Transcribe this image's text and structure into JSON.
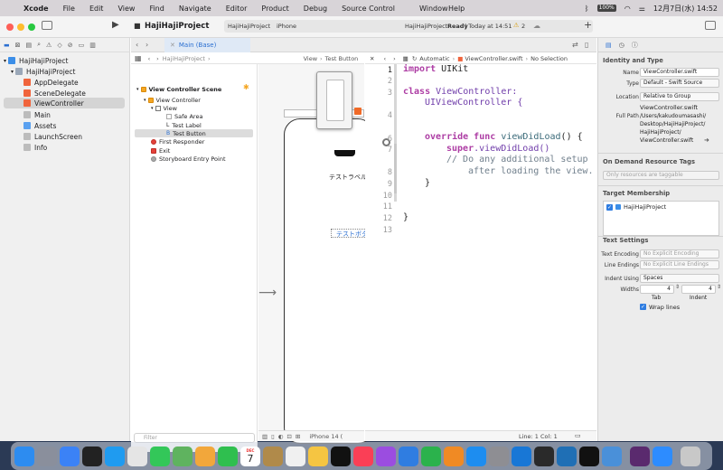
{
  "menubar": {
    "apple": "",
    "app": "Xcode",
    "items": [
      "File",
      "Edit",
      "View",
      "Find",
      "Navigate",
      "Editor",
      "Product",
      "Debug",
      "Source Control"
    ],
    "window": "Window",
    "help": "Help",
    "battery": "100%",
    "clock": "12月7日(水) 14:52"
  },
  "toolbar": {
    "project_name": "HajiHajiProject",
    "scheme": "HajiHajiProject",
    "device": "iPhone",
    "status_project": "HajiHajiProject:",
    "status_ready": "Ready",
    "status_time": "| Today at 14:51",
    "warnings": "2"
  },
  "navigator": {
    "items": [
      {
        "label": "HajiHajiProject",
        "kind": "project"
      },
      {
        "label": "HajiHajiProject",
        "kind": "folder"
      },
      {
        "label": "AppDelegate",
        "kind": "swift"
      },
      {
        "label": "SceneDelegate",
        "kind": "swift"
      },
      {
        "label": "ViewController",
        "kind": "swift"
      },
      {
        "label": "Main",
        "kind": "storyboard"
      },
      {
        "label": "Assets",
        "kind": "assets"
      },
      {
        "label": "LaunchScreen",
        "kind": "storyboard"
      },
      {
        "label": "Info",
        "kind": "plist"
      }
    ],
    "filter_placeholder": "Filter"
  },
  "editor_tab": {
    "label": "Main (Base)"
  },
  "ib_breadcrumb": {
    "project": "HajiHajiProject",
    "view": "View",
    "item": "Test Button"
  },
  "scene_outline": {
    "items": [
      {
        "label": "View Controller Scene"
      },
      {
        "label": "View Controller"
      },
      {
        "label": "View"
      },
      {
        "label": "Safe Area"
      },
      {
        "label": "Test Label"
      },
      {
        "label": "Test Button"
      },
      {
        "label": "First Responder"
      },
      {
        "label": "Exit"
      },
      {
        "label": "Storyboard Entry Point"
      }
    ],
    "filter_placeholder": "Filter"
  },
  "canvas": {
    "label_text": "テストラベル",
    "button_text": "テストボタン",
    "device_label": "iPhone 14 ("
  },
  "code_breadcrumb": {
    "mode": "Automatic",
    "file": "ViewController.swift",
    "selection": "No Selection"
  },
  "code": {
    "line_numbers": [
      "1",
      "2",
      "3",
      "4",
      "5",
      "6",
      "7",
      "8",
      "9",
      "10",
      "11",
      "12",
      "13"
    ],
    "line1_kw": "import",
    "line1_mod": "UIKit",
    "line3_kw": "class",
    "line3_name": "ViewController:",
    "line3_super": "UIViewController {",
    "line5_kw": "override func",
    "line5_fn": "viewDidLoad",
    "line5_rest": "() {",
    "line6_kw": "super",
    "line6_rest": ".viewDidLoad()",
    "line7": "// Do any additional setup",
    "line7b": "after loading the view.",
    "line8": "}",
    "line11": "}"
  },
  "status_bar": {
    "position": "Line: 1  Col: 1"
  },
  "inspector": {
    "identity_title": "Identity and Type",
    "name_label": "Name",
    "name_value": "ViewController.swift",
    "type_label": "Type",
    "type_value": "Default - Swift Source",
    "location_label": "Location",
    "location_value": "Relative to Group",
    "location_file": "ViewController.swift",
    "fullpath_label": "Full Path",
    "fullpath_lines": [
      "/Users/kakudoumasashi/",
      "Desktop/HajiHajiProject/",
      "HajiHajiProject/",
      "ViewController.swift"
    ],
    "odr_title": "On Demand Resource Tags",
    "odr_placeholder": "Only resources are taggable",
    "target_title": "Target Membership",
    "target_name": "HajiHajiProject",
    "text_title": "Text Settings",
    "encoding_label": "Text Encoding",
    "encoding_value": "No Explicit Encoding",
    "endings_label": "Line Endings",
    "endings_value": "No Explicit Line Endings",
    "indent_label": "Indent Using",
    "indent_value": "Spaces",
    "widths_label": "Widths",
    "tab_value": "4",
    "indent_num": "4",
    "tab_caption": "Tab",
    "indent_caption": "Indent",
    "wrap_label": "Wrap lines"
  },
  "dock": {
    "apps": [
      {
        "name": "finder",
        "color": "#2d8cf0"
      },
      {
        "name": "launchpad",
        "color": "#8a8f9c"
      },
      {
        "name": "mail",
        "color": "#3b82f6"
      },
      {
        "name": "terminal",
        "color": "#222222"
      },
      {
        "name": "safari",
        "color": "#1f9bf0"
      },
      {
        "name": "chrome",
        "color": "#e5e5e5"
      },
      {
        "name": "messages",
        "color": "#33c759"
      },
      {
        "name": "maps",
        "color": "#5fb35f"
      },
      {
        "name": "photos",
        "color": "#f2a73b"
      },
      {
        "name": "facetime",
        "color": "#2fbf4f"
      },
      {
        "name": "calendar",
        "color": "#ffffff"
      },
      {
        "name": "notes",
        "color": "#b08a4a"
      },
      {
        "name": "reminders",
        "color": "#f0f0f0"
      },
      {
        "name": "keynote",
        "color": "#f5c542"
      },
      {
        "name": "tv",
        "color": "#111111"
      },
      {
        "name": "music",
        "color": "#fa3f56"
      },
      {
        "name": "podcasts",
        "color": "#9b4de0"
      },
      {
        "name": "keynote2",
        "color": "#2f7de1"
      },
      {
        "name": "numbers",
        "color": "#2bb24c"
      },
      {
        "name": "pages",
        "color": "#f08a24"
      },
      {
        "name": "appstore",
        "color": "#1d8df0"
      },
      {
        "name": "settings",
        "color": "#8e8e93"
      },
      {
        "name": "xcode",
        "color": "#1877d6"
      },
      {
        "name": "simulator",
        "color": "#2a2a2a"
      },
      {
        "name": "vscode",
        "color": "#1f6fb5"
      },
      {
        "name": "chatgpt",
        "color": "#111111"
      },
      {
        "name": "downloads",
        "color": "#4a90d9"
      },
      {
        "name": "slack",
        "color": "#5a2a6e"
      },
      {
        "name": "zoom",
        "color": "#2d8cff"
      },
      {
        "name": "trash",
        "color": "#c8c8c8"
      }
    ],
    "calendar_month": "DEC",
    "calendar_day": "7"
  }
}
